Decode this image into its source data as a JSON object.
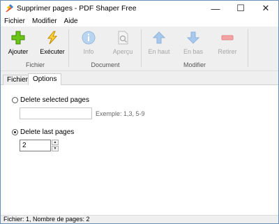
{
  "window": {
    "title": "Supprimer pages - PDF Shaper Free",
    "minimize": "—",
    "maximize": "☐",
    "close": "✕"
  },
  "menu": {
    "items": [
      "Fichier",
      "Modifier",
      "Aide"
    ]
  },
  "ribbon": {
    "buttons": [
      {
        "label": "Ajouter",
        "icon": "plus-icon",
        "enabled": true,
        "color": "#5cb800"
      },
      {
        "label": "Exécuter",
        "icon": "lightning-icon",
        "enabled": true,
        "color": "#e6b800"
      },
      {
        "label": "Info",
        "icon": "info-icon",
        "enabled": false,
        "color": "#9fc4e8"
      },
      {
        "label": "Aperçu",
        "icon": "preview-icon",
        "enabled": false,
        "color": "#b9b9b9"
      },
      {
        "label": "En haut",
        "icon": "arrow-up-icon",
        "enabled": false,
        "color": "#9fc4e8"
      },
      {
        "label": "En bas",
        "icon": "arrow-down-icon",
        "enabled": false,
        "color": "#9fc4e8"
      },
      {
        "label": "Retirer",
        "icon": "minus-icon",
        "enabled": false,
        "color": "#f2a0a0"
      }
    ],
    "groups": [
      "Fichier",
      "Document",
      "Modifier"
    ]
  },
  "tabs": [
    {
      "label": "Fichier",
      "active": false
    },
    {
      "label": "Options",
      "active": true
    }
  ],
  "options": {
    "delete_selected_label": "Delete selected pages",
    "delete_selected_checked": false,
    "pages_value": "",
    "pages_hint": "Exemple: 1,3, 5-9",
    "delete_last_label": "Delete last pages",
    "delete_last_checked": true,
    "last_pages_value": "2"
  },
  "status": {
    "text": "Fichier: 1, Nombre de pages: 2"
  }
}
